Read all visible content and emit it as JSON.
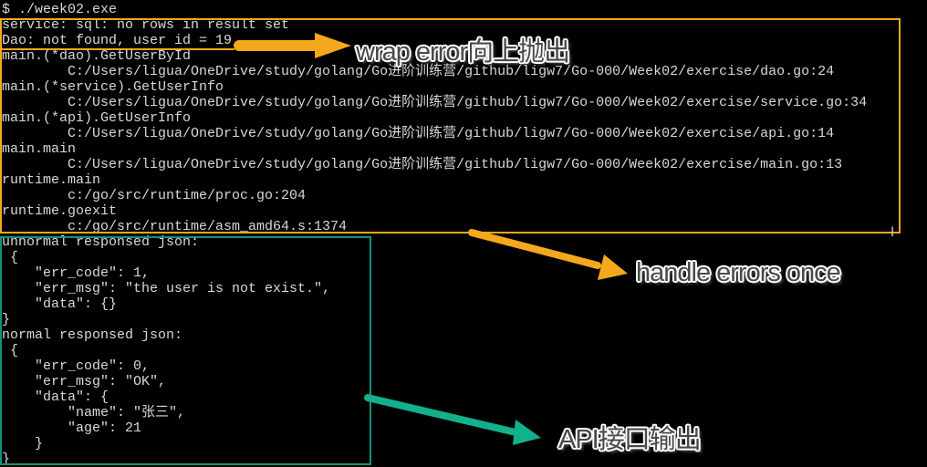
{
  "terminal": {
    "lines": [
      "$ ./week02.exe",
      "service: sql: no rows in result set",
      "Dao: not found, user id = 19",
      "main.(*dao).GetUserById",
      "        C:/Users/ligua/OneDrive/study/golang/Go进阶训练营/github/ligw7/Go-000/Week02/exercise/dao.go:24",
      "main.(*service).GetUserInfo",
      "        C:/Users/ligua/OneDrive/study/golang/Go进阶训练营/github/ligw7/Go-000/Week02/exercise/service.go:34",
      "main.(*api).GetUserInfo",
      "        C:/Users/ligua/OneDrive/study/golang/Go进阶训练营/github/ligw7/Go-000/Week02/exercise/api.go:14",
      "main.main",
      "        C:/Users/ligua/OneDrive/study/golang/Go进阶训练营/github/ligw7/Go-000/Week02/exercise/main.go:13",
      "runtime.main",
      "        c:/go/src/runtime/proc.go:204",
      "runtime.goexit",
      "        c:/go/src/runtime/asm_amd64.s:1374",
      "unnormal responsed json:",
      " {",
      "    \"err_code\": 1,",
      "    \"err_msg\": \"the user is not exist.\",",
      "    \"data\": {}",
      "}",
      "normal responsed json:",
      " {",
      "    \"err_code\": 0,",
      "    \"err_msg\": \"OK\",",
      "    \"data\": {",
      "        \"name\": \"张三\",",
      "        \"age\": 21",
      "    }",
      "}"
    ]
  },
  "annotations": {
    "wrap": "wrap error向上抛出",
    "handle": "handle errors once",
    "api": "API接口输出"
  },
  "colors": {
    "orange": "#f5a81c",
    "teal": "#12947a"
  }
}
